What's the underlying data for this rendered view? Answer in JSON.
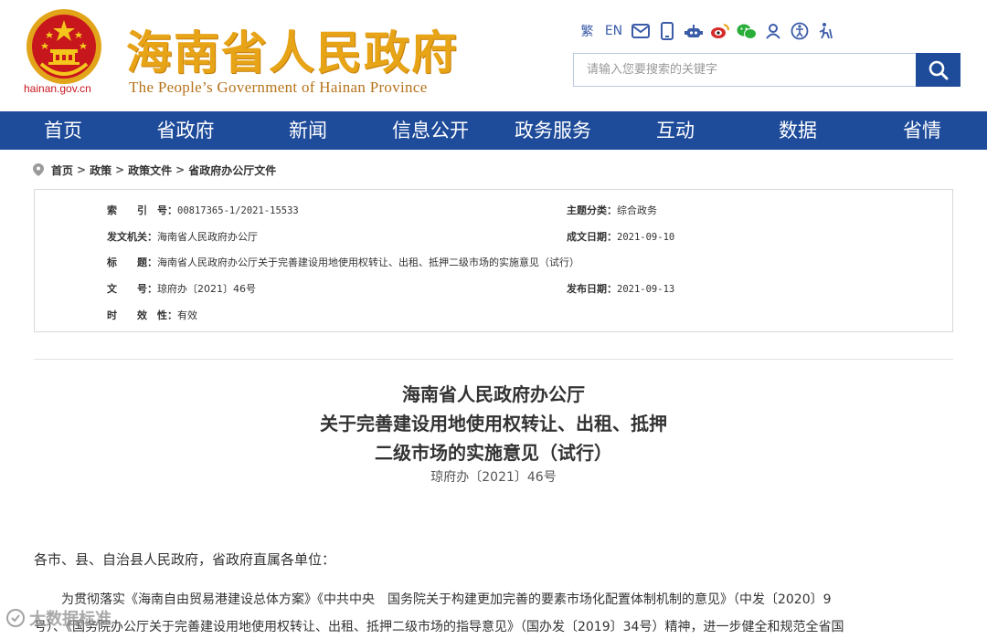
{
  "header": {
    "domain": "hainan.gov.cn",
    "site_title": "海南省人民政府",
    "site_subtitle": "The People’s Government  of Hainan Province",
    "lang_trad": "繁",
    "lang_en": "EN",
    "icons": [
      "mail-icon",
      "mobile-icon",
      "robot-icon",
      "weibo-icon",
      "wechat-icon",
      "user-icon",
      "accessibility-icon",
      "elder-mode-icon"
    ],
    "search_placeholder": "请输入您要搜索的关键字"
  },
  "nav": {
    "items": [
      "首页",
      "省政府",
      "新闻",
      "信息公开",
      "政务服务",
      "互动",
      "数据",
      "省情"
    ]
  },
  "breadcrumb": {
    "items": [
      "首页",
      "政策",
      "政策文件",
      "省政府办公厅文件"
    ],
    "separator": ">"
  },
  "info": {
    "index_label": "索　　引　号：",
    "index_value": "00817365-1/2021-15533",
    "category_label": "主题分类：",
    "category_value": "综合政务",
    "issuer_label": "发文机关：",
    "issuer_value": "海南省人民政府办公厅",
    "date_label": "成文日期：",
    "date_value": "2021-09-10",
    "title_label": "标　　题：",
    "title_value": "海南省人民政府办公厅关于完善建设用地使用权转让、出租、抵押二级市场的实施意见（试行）",
    "docno_label": "文　　号：",
    "docno_value": "琼府办〔2021〕46号",
    "publish_label": "发布日期：",
    "publish_value": "2021-09-13",
    "validity_label": "时　　效　性：",
    "validity_value": "有效"
  },
  "document": {
    "title_line1": "海南省人民政府办公厅",
    "title_line2": "关于完善建设用地使用权转让、出租、抵押",
    "title_line3": "二级市场的实施意见（试行）",
    "doc_number": "琼府办〔2021〕46号",
    "salutation": "各市、县、自治县人民政府，省政府直属各单位：",
    "para1_line1": "为贯彻落实《海南自由贸易港建设总体方案》《中共中央　国务院关于构建更加完善的要素市场化配置体制机制的意见》（中发〔2020〕9",
    "para1_line2": "号）、《国务院办公厅关于完善建设用地使用权转让、出租、抵押二级市场的指导意见》（国办发〔2019〕34号）精神，进一步健全和规范全省国"
  },
  "watermark": {
    "text": "大数据标准"
  },
  "colors": {
    "nav_bg": "#1e4b9a",
    "title_gold": "#e8a417",
    "emblem_red": "#c8161d"
  }
}
